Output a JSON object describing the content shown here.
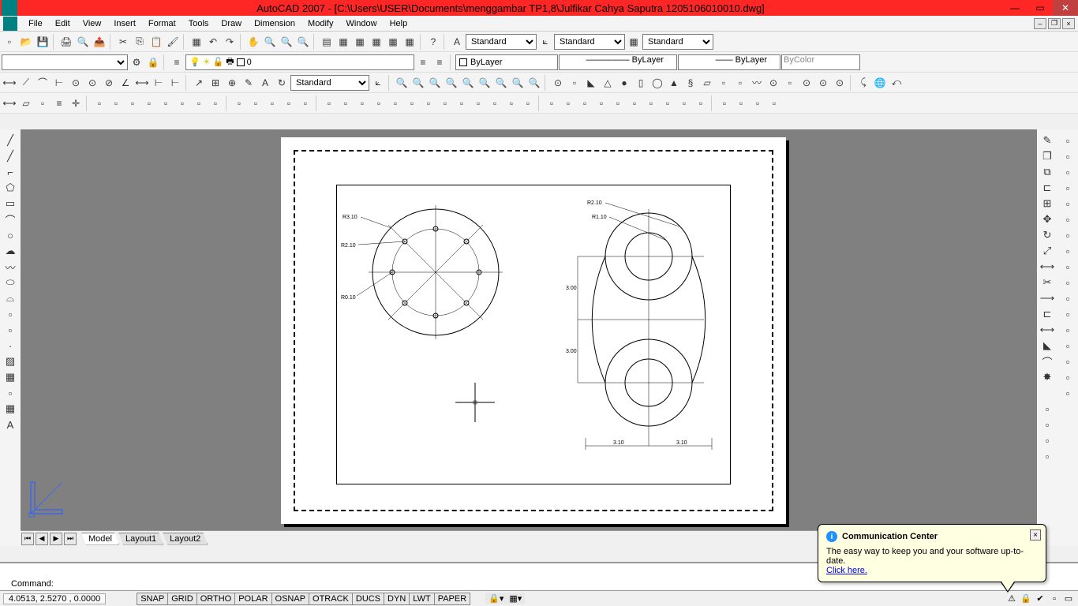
{
  "title": "AutoCAD 2007 - [C:\\Users\\USER\\Documents\\menggambar TP1,8\\Julfikar Cahya Saputra 1205106010010.dwg]",
  "menu": [
    "File",
    "Edit",
    "View",
    "Insert",
    "Format",
    "Tools",
    "Draw",
    "Dimension",
    "Modify",
    "Window",
    "Help"
  ],
  "styles": {
    "text": "Standard",
    "dim": "Standard",
    "table": "Standard"
  },
  "layer": {
    "current": "0",
    "linetype": "ByLayer",
    "lineweight": "ByLayer",
    "plotstyle": "ByLayer",
    "color": "ByColor"
  },
  "dimstyle": "Standard",
  "tabs": [
    "Model",
    "Layout1",
    "Layout2"
  ],
  "active_tab": "Model",
  "command_prompt": "Command:",
  "coords": "4.0513, 2.5270 , 0.0000",
  "status_toggles": [
    "SNAP",
    "GRID",
    "ORTHO",
    "POLAR",
    "OSNAP",
    "OTRACK",
    "DUCS",
    "DYN",
    "LWT",
    "PAPER"
  ],
  "balloon": {
    "title": "Communication Center",
    "text": "The easy way to keep you and your software up-to-date.",
    "link": "Click here."
  },
  "drawing_labels": {
    "r310": "R3.10",
    "r210": "R2.10",
    "r010": "R0.10",
    "r110": "R1.10",
    "d300a": "3.00",
    "d300b": "3.00",
    "d310a": "3.10",
    "d310b": "3.10"
  }
}
